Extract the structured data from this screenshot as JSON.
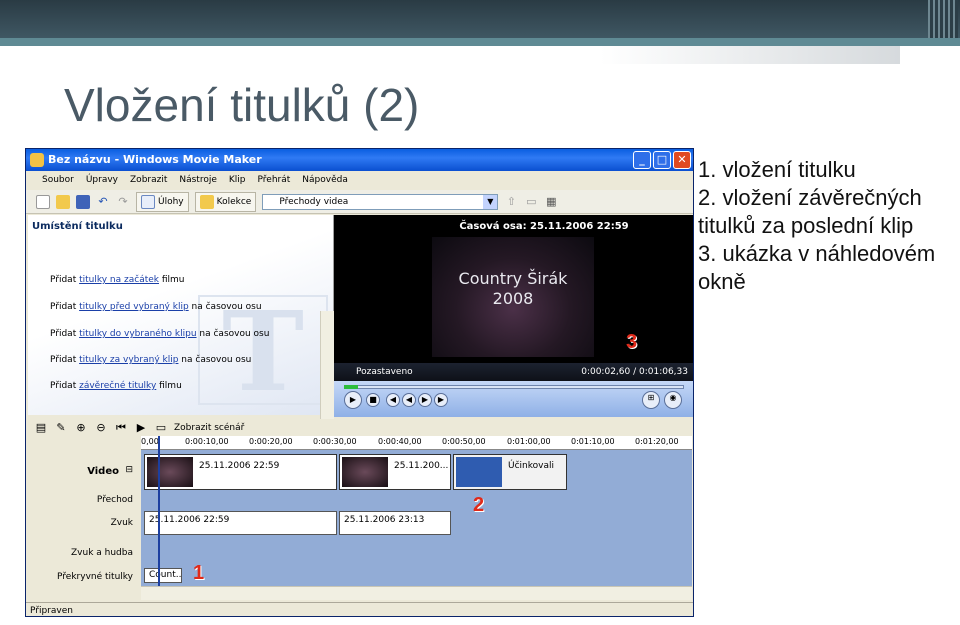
{
  "slide": {
    "title": "Vložení titulků (2)",
    "notes": [
      "1. vložení titulku",
      "2. vložení závěrečných",
      "titulků za poslední klip",
      "3. ukázka v náhledovém",
      "okně"
    ]
  },
  "window": {
    "title": "Bez názvu - Windows Movie Maker",
    "buttons": {
      "minimize": "_",
      "maximize": "□",
      "close": "✕"
    }
  },
  "menu": [
    "Soubor",
    "Úpravy",
    "Zobrazit",
    "Nástroje",
    "Klip",
    "Přehrát",
    "Nápověda"
  ],
  "toolbar": {
    "tasks_label": "Úlohy",
    "collections_label": "Kolekce",
    "collection_select": "Přechody videa"
  },
  "task_pane": {
    "heading": "Umístění titulku",
    "links": [
      {
        "prefix": "Přidat ",
        "link": "titulky na začátek",
        "suffix": " filmu"
      },
      {
        "prefix": "Přidat ",
        "link": "titulky před vybraný klip",
        "suffix": " na časovou osu"
      },
      {
        "prefix": "Přidat ",
        "link": "titulky do vybraného klipu",
        "suffix": " na časovou osu"
      },
      {
        "prefix": "Přidat ",
        "link": "titulky za vybraný klip",
        "suffix": " na časovou osu"
      },
      {
        "prefix": "Přidat ",
        "link": "závěrečné titulky",
        "suffix": " filmu"
      }
    ],
    "decoration": "T"
  },
  "preview": {
    "title": "Časová osa: 25.11.2006 22:59",
    "caption_line1": "Country Širák",
    "caption_line2": "2008",
    "status": "Pozastaveno",
    "time": "0:00:02,60 / 0:01:06,33",
    "position_fraction": 0.04
  },
  "timeline": {
    "storyboard_label": "Zobrazit scénář",
    "ruler": [
      "0,00",
      "0:00:10,00",
      "0:00:20,00",
      "0:00:30,00",
      "0:00:40,00",
      "0:00:50,00",
      "0:01:00,00",
      "0:01:10,00",
      "0:01:20,00"
    ],
    "tracks": {
      "video": "Video",
      "expand": "⊟",
      "transition": "Přechod",
      "audio": "Zvuk",
      "audio_music": "Zvuk a hudba",
      "title_overlay": "Překryvné titulky"
    },
    "video_clips": [
      "25.11.2006 22:59",
      "25.11.200...",
      "Účinkovali"
    ],
    "audio_clips": [
      "25.11.2006 22:59",
      "25.11.2006 23:13"
    ],
    "overlay_clip": "Count..."
  },
  "markers": [
    "1",
    "2",
    "3"
  ],
  "status_bar": "Připraven",
  "colors": {
    "marker": "#e02a1a",
    "titlebar": "#0a5ee0",
    "timeline": "#92acd6"
  }
}
